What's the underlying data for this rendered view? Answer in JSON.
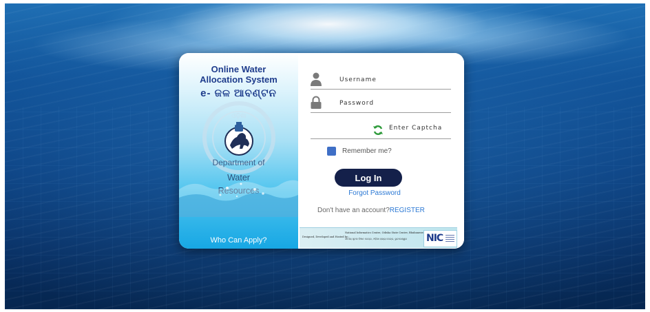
{
  "branding": {
    "title_line1": "Online Water",
    "title_line2": "Allocation System",
    "subtitle_odia": "e- ଜଳ ଆବଣ୍ଟନ",
    "department_line": "Department of",
    "water_line": "Water",
    "resources_line": "Resources",
    "who_can_apply": "Who Can Apply?"
  },
  "form": {
    "username_placeholder": "Username",
    "password_placeholder": "Password",
    "captcha_placeholder": "Enter Captcha",
    "remember_label": "Remember me?",
    "login_label": "Log In",
    "forgot_label": "Forgot Password",
    "no_account_text": "Don't have an account?",
    "register_label": "REGISTER"
  },
  "footer": {
    "designed_by": "Designed, Developed and Hosted by :",
    "nic_line1": "National Informatics Centre, Odisha State Centre, Bhubaneswar",
    "nic_line2": "ଜାତୀୟ ସୂଚନା ବିଜ୍ଞାନ କେନ୍ଦ୍ର, ଓଡ଼ିଶା ରାଜ୍ୟ କେନ୍ଦ୍ର, ଭୁବନେଶ୍ୱର",
    "nic_logo_text": "NIC"
  },
  "colors": {
    "accent": "#2b78d4",
    "button": "#14204a",
    "heading": "#1e3c8c",
    "checkbox": "#3f6fc6",
    "refresh": "#2e9a3a"
  },
  "icons": {
    "username": "user-icon",
    "password": "lock-icon",
    "captcha": "refresh-icon",
    "emblem": "state-emblem-icon"
  }
}
